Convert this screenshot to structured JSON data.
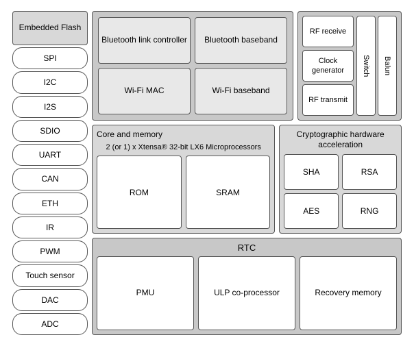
{
  "sidebar": {
    "title": "Embedded Flash",
    "items": [
      {
        "label": "SPI"
      },
      {
        "label": "I2C"
      },
      {
        "label": "I2S"
      },
      {
        "label": "SDIO"
      },
      {
        "label": "UART"
      },
      {
        "label": "CAN"
      },
      {
        "label": "ETH"
      },
      {
        "label": "IR"
      },
      {
        "label": "PWM"
      },
      {
        "label": "Touch sensor"
      },
      {
        "label": "DAC"
      },
      {
        "label": "ADC"
      }
    ]
  },
  "wireless": {
    "blocks": [
      {
        "label": "Bluetooth link controller"
      },
      {
        "label": "Bluetooth baseband"
      },
      {
        "label": "Wi-Fi MAC"
      },
      {
        "label": "Wi-Fi baseband"
      }
    ]
  },
  "rf": {
    "blocks": [
      {
        "label": "RF receive"
      },
      {
        "label": "Clock generator"
      },
      {
        "label": "RF transmit"
      }
    ],
    "side": [
      {
        "label": "Switch"
      },
      {
        "label": "Balun"
      }
    ]
  },
  "core": {
    "section_label": "Core and memory",
    "description": "2 (or 1) x Xtensa® 32-bit LX6 Microprocessors",
    "chips": [
      {
        "label": "ROM"
      },
      {
        "label": "SRAM"
      }
    ]
  },
  "crypto": {
    "section_label": "Cryptographic hardware acceleration",
    "chips": [
      {
        "label": "SHA"
      },
      {
        "label": "RSA"
      },
      {
        "label": "AES"
      },
      {
        "label": "RNG"
      }
    ]
  },
  "rtc": {
    "section_label": "RTC",
    "chips": [
      {
        "label": "PMU"
      },
      {
        "label": "ULP co-processor"
      },
      {
        "label": "Recovery memory"
      }
    ]
  }
}
